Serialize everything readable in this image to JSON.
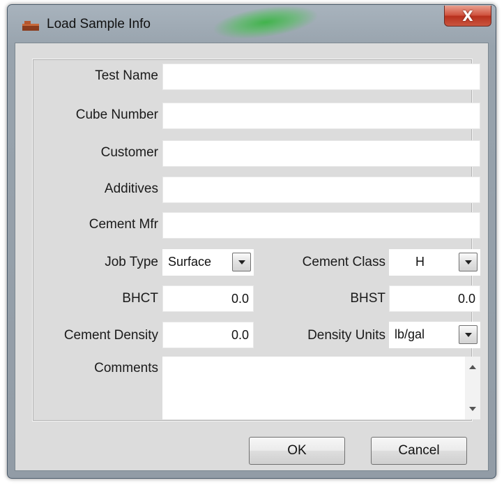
{
  "window": {
    "title": "Load Sample Info",
    "close_glyph": "X"
  },
  "form": {
    "test_name": {
      "label": "Test Name",
      "value": ""
    },
    "cube_number": {
      "label": "Cube Number",
      "value": ""
    },
    "customer": {
      "label": "Customer",
      "value": ""
    },
    "additives": {
      "label": "Additives",
      "value": ""
    },
    "cement_mfr": {
      "label": "Cement Mfr",
      "value": ""
    },
    "job_type": {
      "label": "Job Type",
      "value": "Surface"
    },
    "cement_class": {
      "label": "Cement Class",
      "value": "H"
    },
    "bhct": {
      "label": "BHCT",
      "value": "0.0"
    },
    "bhst": {
      "label": "BHST",
      "value": "0.0"
    },
    "cement_density": {
      "label": "Cement Density",
      "value": "0.0"
    },
    "density_units": {
      "label": "Density Units",
      "value": "lb/gal"
    },
    "comments": {
      "label": "Comments",
      "value": ""
    }
  },
  "buttons": {
    "ok": "OK",
    "cancel": "Cancel"
  },
  "icons": {
    "app": "app-icon",
    "close": "close-icon",
    "dropdown": "chevron-down-icon",
    "scroll_up": "scroll-up-icon",
    "scroll_down": "scroll-down-icon"
  },
  "colors": {
    "close_button": "#c9402b",
    "title_glow": "#3cb446",
    "field_bg": "#ffffff"
  }
}
